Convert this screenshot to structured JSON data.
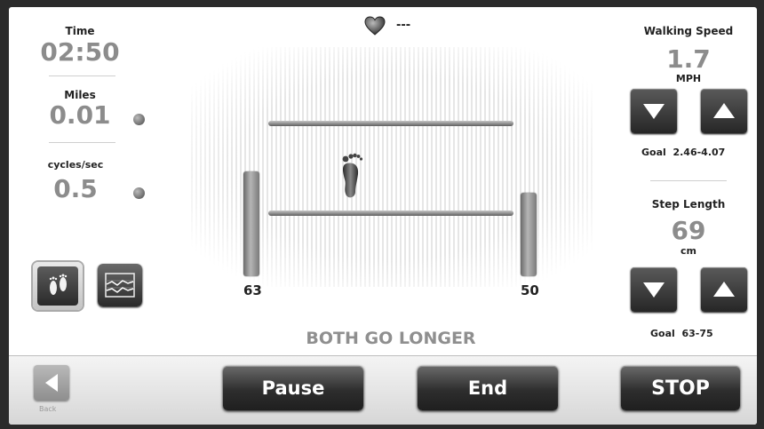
{
  "left_panel": {
    "time": {
      "label": "Time",
      "value": "02:50"
    },
    "miles": {
      "label": "Miles",
      "value": "0.01"
    },
    "cycles": {
      "label": "cycles/sec",
      "value": "0.5"
    },
    "footprint_icon": "footprints-icon",
    "graph_icon": "graph-icon"
  },
  "header": {
    "heart_icon": "heart-icon",
    "heart_rate": "---"
  },
  "center": {
    "left_bar_value": "63",
    "right_bar_value": "50",
    "status_text": "BOTH GO LONGER",
    "foot_icon": "foot-icon"
  },
  "right_panel": {
    "walking_speed": {
      "label": "Walking Speed",
      "value": "1.7",
      "unit": "MPH",
      "goal_label": "Goal",
      "goal_range": "2.46-4.07"
    },
    "step_length": {
      "label": "Step Length",
      "value": "69",
      "unit": "cm",
      "goal_label": "Goal",
      "goal_range": "63-75"
    }
  },
  "bottom_bar": {
    "back_label": "Back",
    "pause_label": "Pause",
    "end_label": "End",
    "stop_label": "STOP"
  }
}
